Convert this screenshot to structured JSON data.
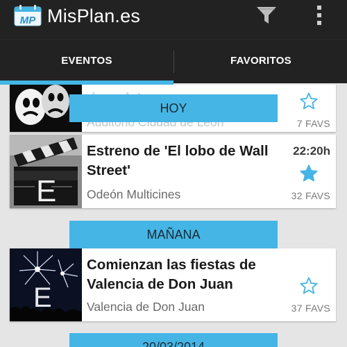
{
  "app": {
    "title": "MisPlan.es",
    "logo_text": "MP",
    "logo_icon": "calendar-logo-icon",
    "colors": {
      "accent": "#45b5e5",
      "actionbar": "#222222",
      "background": "#e5e5e5"
    }
  },
  "toolbar": {
    "filter_icon": "filter-icon",
    "overflow_icon": "overflow-menu-icon"
  },
  "tabs": [
    {
      "label": "EVENTOS",
      "selected": true
    },
    {
      "label": "FAVORITOS",
      "selected": false
    }
  ],
  "sections": [
    {
      "label": "HOY"
    },
    {
      "label": "MAÑANA"
    },
    {
      "label": "20/03/2014"
    }
  ],
  "events": [
    {
      "title_partial": "duende'",
      "venue": "Auditorio Ciudad de León",
      "favs": "7 FAVS",
      "favorited": false
    },
    {
      "title": "Estreno de 'El lobo de Wall Street'",
      "venue": "Odeón Multicines",
      "time": "22:20h",
      "favs": "32 FAVS",
      "favorited": true
    },
    {
      "title": "Comienzan las fiestas de Valencia de Don Juan",
      "venue": "Valencia de Don Juan",
      "favs": "37 FAVS",
      "favorited": false
    }
  ]
}
